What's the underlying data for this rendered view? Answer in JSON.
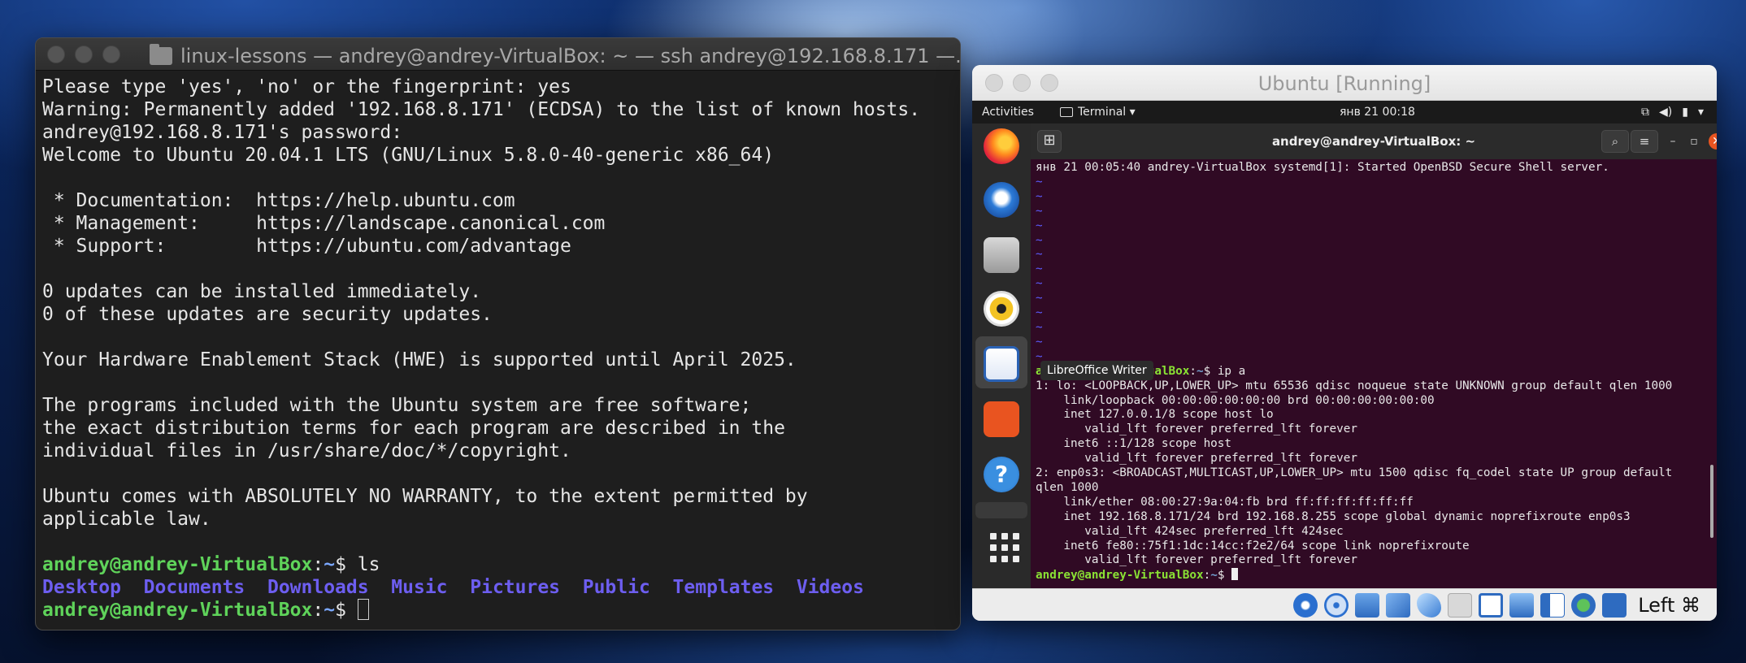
{
  "mac_terminal": {
    "title": "linux-lessons — andrey@andrey-VirtualBox: ~ — ssh andrey@192.168.8.171 —...",
    "lines": [
      "Please type 'yes', 'no' or the fingerprint: yes",
      "Warning: Permanently added '192.168.8.171' (ECDSA) to the list of known hosts.",
      "andrey@192.168.8.171's password:",
      "Welcome to Ubuntu 20.04.1 LTS (GNU/Linux 5.8.0-40-generic x86_64)",
      "",
      " * Documentation:  https://help.ubuntu.com",
      " * Management:     https://landscape.canonical.com",
      " * Support:        https://ubuntu.com/advantage",
      "",
      "0 updates can be installed immediately.",
      "0 of these updates are security updates.",
      "",
      "Your Hardware Enablement Stack (HWE) is supported until April 2025.",
      "",
      "The programs included with the Ubuntu system are free software;",
      "the exact distribution terms for each program are described in the",
      "individual files in /usr/share/doc/*/copyright.",
      "",
      "Ubuntu comes with ABSOLUTELY NO WARRANTY, to the extent permitted by",
      "applicable law.",
      ""
    ],
    "prompt_user": "andrey@andrey-VirtualBox",
    "prompt_sep": ":",
    "prompt_path": "~",
    "prompt_end": "$ ",
    "command": "ls",
    "ls_output": [
      "Desktop",
      "Documents",
      "Downloads",
      "Music",
      "Pictures",
      "Public",
      "Templates",
      "Videos"
    ]
  },
  "vbox": {
    "title": "Ubuntu [Running]",
    "topbar": {
      "activities": "Activities",
      "app": "Terminal ▾",
      "clock": "янв 21  00:18",
      "sys_icons": [
        "network-icon",
        "volume-icon",
        "battery-icon",
        "dropdown-icon"
      ]
    },
    "dock_tooltip": "LibreOffice Writer",
    "gnome_terminal": {
      "title": "andrey@andrey-VirtualBox: ~",
      "log_line": "янв 21 00:05:40 andrey-VirtualBox systemd[1]: Started OpenBSD Secure Shell server.",
      "tilde_count": 13,
      "prompt_user": "andrey@andrey-VirtualBox",
      "prompt_path": "~",
      "prompt_partial_hidden": "a",
      "command": "ip a",
      "output": [
        "1: lo: <LOOPBACK,UP,LOWER_UP> mtu 65536 qdisc noqueue state UNKNOWN group default qlen 1000",
        "    link/loopback 00:00:00:00:00:00 brd 00:00:00:00:00:00",
        "    inet 127.0.0.1/8 scope host lo",
        "       valid_lft forever preferred_lft forever",
        "    inet6 ::1/128 scope host",
        "       valid_lft forever preferred_lft forever",
        "2: enp0s3: <BROADCAST,MULTICAST,UP,LOWER_UP> mtu 1500 qdisc fq_codel state UP group default",
        "qlen 1000",
        "    link/ether 08:00:27:9a:04:fb brd ff:ff:ff:ff:ff:ff",
        "    inet 192.168.8.171/24 brd 192.168.8.255 scope global dynamic noprefixroute enp0s3",
        "       valid_lft 424sec preferred_lft 424sec",
        "    inet6 fe80::75f1:1dc:14cc:f2e2/64 scope link noprefixroute",
        "       valid_lft forever preferred_lft forever"
      ]
    },
    "host_key": "Left ⌘"
  }
}
